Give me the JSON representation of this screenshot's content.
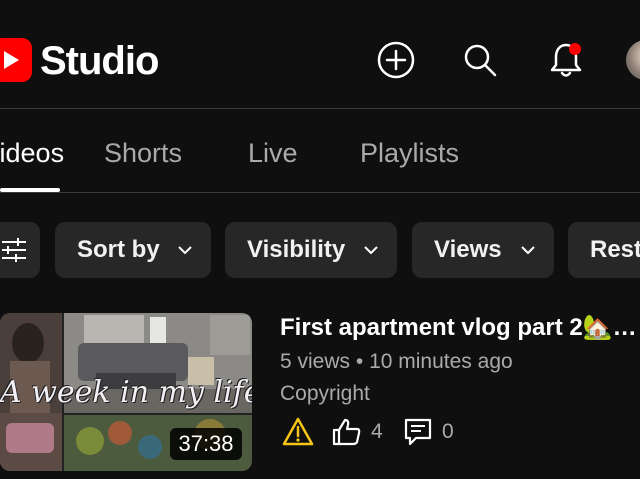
{
  "header": {
    "logo_text": "Studio",
    "icons": [
      "create-icon",
      "search-icon",
      "notifications-icon",
      "account-avatar"
    ],
    "notification_badge_color": "#ff0000"
  },
  "tabs": [
    {
      "label": "Videos",
      "active": true
    },
    {
      "label": "Shorts",
      "active": false
    },
    {
      "label": "Live",
      "active": false
    },
    {
      "label": "Playlists",
      "active": false
    }
  ],
  "filters": {
    "icon": "filter-icon",
    "chips": [
      {
        "label": "Sort by"
      },
      {
        "label": "Visibility"
      },
      {
        "label": "Views"
      },
      {
        "label": "Restrictions"
      }
    ]
  },
  "video": {
    "title": "First apartment vlog part 2🏡…",
    "views": "5 views",
    "separator": "•",
    "uploaded": "10 minutes ago",
    "restriction": "Copyright",
    "likes": "4",
    "comments": "0",
    "duration": "37:38",
    "thumbnail_overlay_text": "A week in my life"
  },
  "colors": {
    "background": "#0f0f0f",
    "chip_bg": "#272727",
    "accent_red": "#ff0000",
    "warning_yellow": "#f5c518",
    "secondary_text": "#aaaaaa"
  }
}
